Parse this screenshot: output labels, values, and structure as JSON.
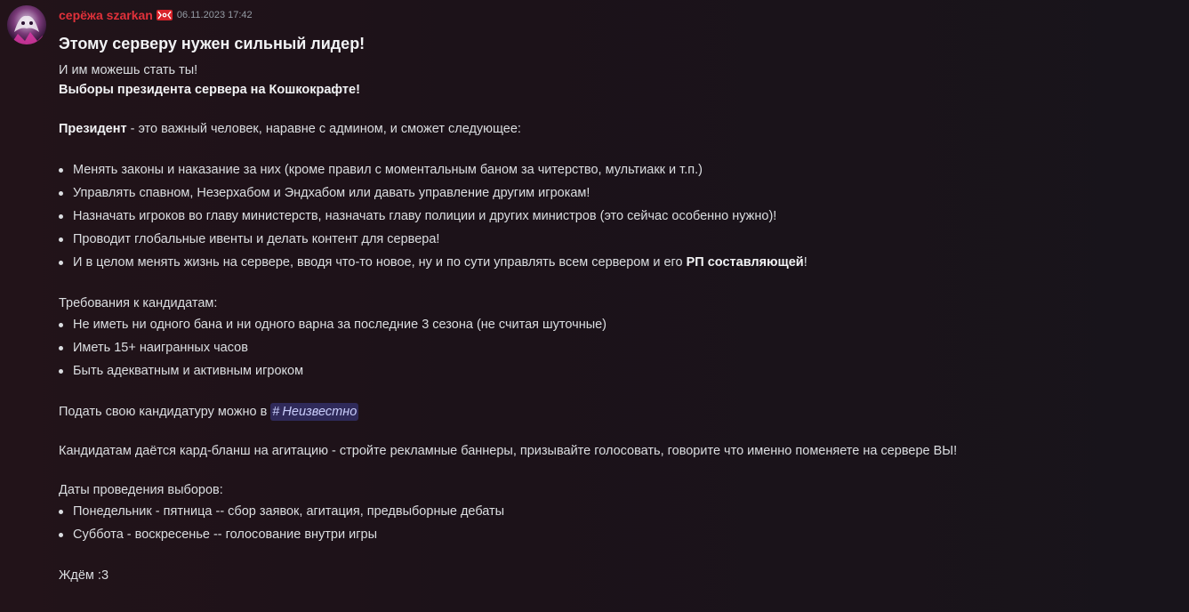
{
  "message": {
    "username": "серёжа szarkan",
    "timestamp": "06.11.2023 17:42",
    "title": "Этому серверу нужен сильный лидер!",
    "intro_line1": "И им можешь стать ты!",
    "intro_line2": "Выборы президента сервера на Кошкокрафте!",
    "president_bold": "Президент",
    "president_rest": " - это важный человек, наравне с админом, и сможет следующее:",
    "powers": [
      "Менять законы и наказание за них (кроме правил с моментальным баном за читерство, мультиакк и т.п.)",
      "Управлять спавном, Незерхабом и Эндхабом или давать управление другим игрокам!",
      "Назначать игроков во главу министерств, назначать главу полиции и других министров (это сейчас особенно нужно)!",
      "Проводит глобальные ивенты и делать контент для сервера!"
    ],
    "power_last_prefix": "И в целом менять жизнь на сервере, вводя что-то новое, ну и по сути управлять всем сервером и его ",
    "power_last_bold": "РП составляющей",
    "power_last_suffix": "!",
    "requirements_heading": "Требования к кандидатам:",
    "requirements": [
      "Не иметь ни одного бана и ни одного варна за последние 3 сезона (не считая шуточные)",
      "Иметь 15+ наигранных часов",
      "Быть адекватным и активным игроком"
    ],
    "submit_text": "Подать свою кандидатуру можно в ",
    "channel_mention": "Неизвестно",
    "agitation_text": "Кандидатам даётся кард-бланш на агитацию - стройте рекламные баннеры, призывайте голосовать, говорите что именно поменяете на сервере ВЫ!",
    "dates_heading": "Даты проведения выборов:",
    "dates": [
      "Понедельник - пятница -- сбор заявок, агитация, предвыборные дебаты",
      "Суббота - воскресенье -- голосование внутри игры"
    ],
    "closing": "Ждём :3"
  },
  "colors": {
    "username": "#e0313a",
    "timestamp": "#949ba4",
    "text": "#dbdee1",
    "mention_bg": "#3b3f8a",
    "background": "#1c1219"
  },
  "icons": {
    "avatar": "avatar-image",
    "badge": "role-badge-icon"
  }
}
